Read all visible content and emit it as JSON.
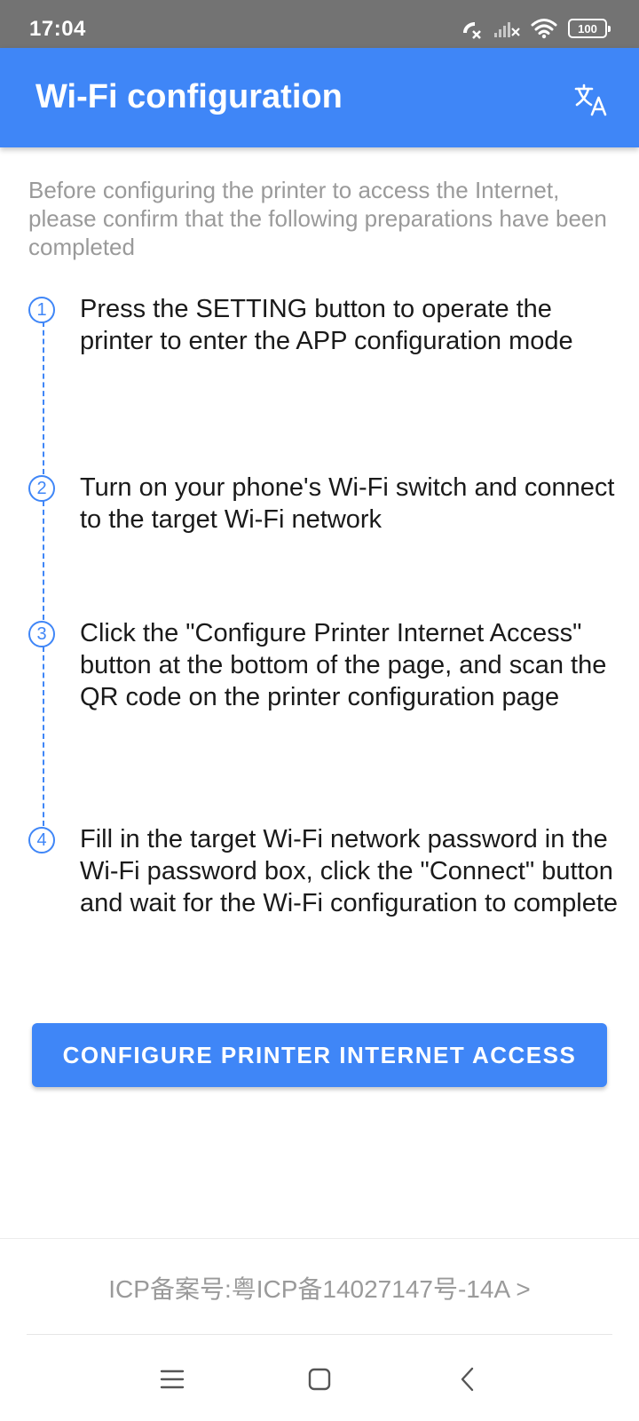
{
  "status_bar": {
    "time": "17:04",
    "battery_level": "100",
    "icons": [
      "call-muted-icon",
      "signal-off-icon",
      "wifi-icon",
      "battery-icon"
    ]
  },
  "app_bar": {
    "title": "Wi-Fi configuration",
    "action_icon": "translate-icon"
  },
  "intro_text": "Before configuring the printer to access the Internet, please confirm that the following preparations have been completed",
  "steps": [
    {
      "number": "1",
      "text": "Press the SETTING button to operate the printer to enter the APP configuration mode"
    },
    {
      "number": "2",
      "text": "Turn on your phone's Wi-Fi switch and connect to the target Wi-Fi network"
    },
    {
      "number": "3",
      "text": "Click the \"Configure Printer Internet Access\" button at the bottom of the page, and scan the QR code on the printer configuration page"
    },
    {
      "number": "4",
      "text": "Fill in the target Wi-Fi network password in the Wi-Fi password box, click the \"Connect\" button and wait for the Wi-Fi configuration to complete"
    }
  ],
  "primary_button": {
    "label": "CONFIGURE PRINTER INTERNET ACCESS"
  },
  "footer": {
    "icp_text": "ICP备案号:粤ICP备14027147号-14A >"
  },
  "nav_bar": {
    "icons": [
      "menu-icon",
      "home-icon",
      "back-icon"
    ]
  },
  "colors": {
    "accent": "#3f86f7",
    "status_bar": "#737373",
    "secondary_text": "#9a9a9a",
    "primary_text": "#1a1a1a"
  }
}
